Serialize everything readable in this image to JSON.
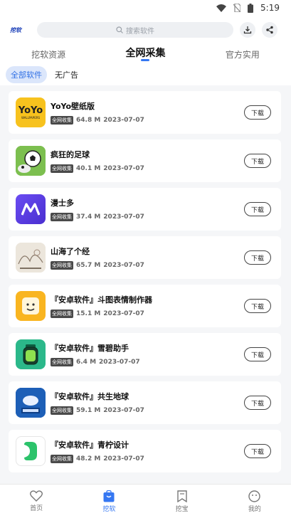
{
  "status_bar": {
    "time": "5:19"
  },
  "header": {
    "logo_text": "挖软",
    "search_placeholder": "搜索软件"
  },
  "main_tabs": [
    {
      "label": "挖软资源"
    },
    {
      "label": "全网采集"
    },
    {
      "label": "官方实用"
    }
  ],
  "filters": [
    {
      "label": "全部软件"
    },
    {
      "label": "无广告"
    }
  ],
  "apps": [
    {
      "name": "YoYo壁纸版",
      "tag": "全网收集",
      "size": "64.8 M",
      "date": "2023-07-07",
      "button": "下载",
      "icon": "yoyo-wallpapers-icon",
      "icon_text": "YoYo",
      "icon_color": "#f7c21e"
    },
    {
      "name": "疯狂的足球",
      "tag": "全网收集",
      "size": "40.1 M",
      "date": "2023-07-07",
      "button": "下载",
      "icon": "soccer-icon",
      "icon_text": "",
      "icon_color": "#5f9b3c"
    },
    {
      "name": "漫士多",
      "tag": "全网收集",
      "size": "37.4 M",
      "date": "2023-07-07",
      "button": "下载",
      "icon": "manshiduo-icon",
      "icon_text": "",
      "icon_color": "#5b3fe0"
    },
    {
      "name": "山海了个经",
      "tag": "全网收集",
      "size": "65.7 M",
      "date": "2023-07-07",
      "button": "下载",
      "icon": "shanhai-icon",
      "icon_text": "",
      "icon_color": "#e6e1d8"
    },
    {
      "name": "『安卓软件』斗图表情制作器",
      "tag": "全网收集",
      "size": "15.1 M",
      "date": "2023-07-07",
      "button": "下载",
      "icon": "meme-maker-icon",
      "icon_text": "",
      "icon_color": "#f9b520"
    },
    {
      "name": "『安卓软件』雪碧助手",
      "tag": "全网收集",
      "size": "6.4 M",
      "date": "2023-07-07",
      "button": "下载",
      "icon": "sprite-assistant-icon",
      "icon_text": "",
      "icon_color": "#2bb88a"
    },
    {
      "name": "『安卓软件』共生地球",
      "tag": "全网收集",
      "size": "59.1 M",
      "date": "2023-07-07",
      "button": "下载",
      "icon": "earth-icon",
      "icon_text": "",
      "icon_color": "#1d5fb7"
    },
    {
      "name": "『安卓软件』青柠设计",
      "tag": "全网收集",
      "size": "48.2 M",
      "date": "2023-07-07",
      "button": "下载",
      "icon": "lime-design-icon",
      "icon_text": "",
      "icon_color": "#ffffff"
    }
  ],
  "bottom_nav": [
    {
      "label": "首页",
      "icon": "heart-icon"
    },
    {
      "label": "挖软",
      "icon": "bag-icon"
    },
    {
      "label": "挖宝",
      "icon": "bookmark-icon"
    },
    {
      "label": "我的",
      "icon": "face-icon"
    }
  ],
  "colors": {
    "accent": "#3577f2",
    "chip_bg": "#dbe6fb"
  }
}
